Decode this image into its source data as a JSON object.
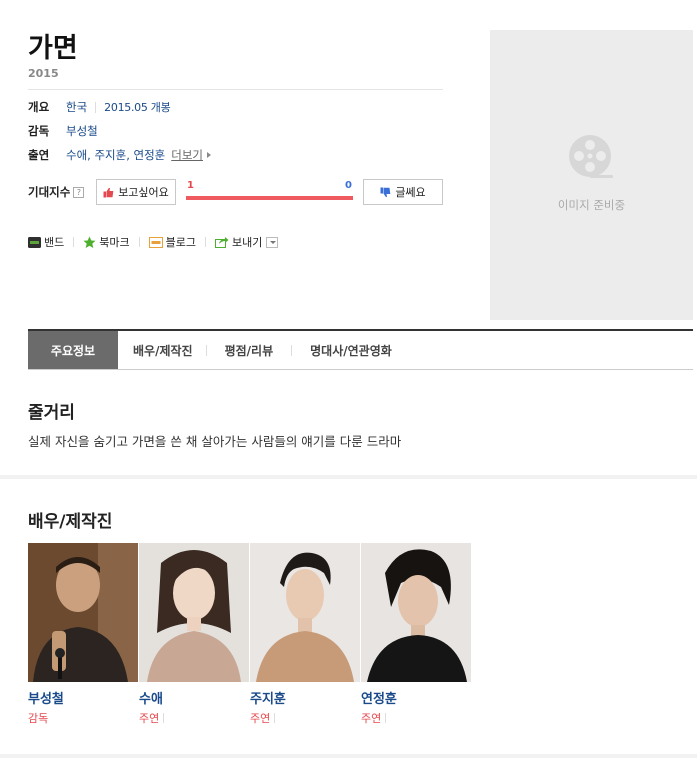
{
  "movie": {
    "title": "가면",
    "year": "2015"
  },
  "info": {
    "overview_label": "개요",
    "country": "한국",
    "release": "2015.05 개봉",
    "director_label": "감독",
    "director": "부성철",
    "cast_label": "출연",
    "cast_names": "수애, 주지훈, 연정훈",
    "more_label": "더보기"
  },
  "expectation": {
    "label": "기대지수",
    "help": "?",
    "want_label": "보고싶어요",
    "meh_label": "글쎄요",
    "want_count": "1",
    "meh_count": "0",
    "want_fraction": 1.0,
    "want_color": "#ee5a60",
    "meh_color": "#3a6fd8"
  },
  "share": {
    "band": "밴드",
    "bookmark": "북마크",
    "blog": "블로그",
    "send": "보내기",
    "band_icon_text": "BAND",
    "blog_icon_text": "blog"
  },
  "poster": {
    "placeholder": "이미지 준비중",
    "icon": "film-reel-icon"
  },
  "tabs": [
    {
      "label": "주요정보",
      "active": true
    },
    {
      "label": "배우/제작진",
      "active": false
    },
    {
      "label": "평점/리뷰",
      "active": false
    },
    {
      "label": "명대사/연관영화",
      "active": false
    }
  ],
  "synopsis": {
    "title": "줄거리",
    "text": "실제 자신을 숨기고 가면을 쓴 채 살아가는 사람들의 얘기를 다룬 드라마"
  },
  "cast_section": {
    "title": "배우/제작진",
    "people": [
      {
        "name": "부성철",
        "role": "감독"
      },
      {
        "name": "수애",
        "role": "주연"
      },
      {
        "name": "주지훈",
        "role": "주연"
      },
      {
        "name": "연정훈",
        "role": "주연"
      }
    ]
  }
}
